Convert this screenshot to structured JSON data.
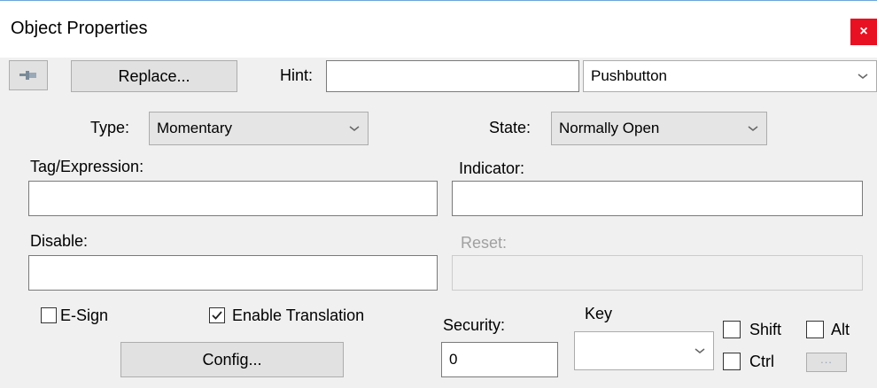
{
  "window": {
    "title": "Object Properties",
    "close_label": "×"
  },
  "toolbar": {
    "replace_label": "Replace...",
    "hint_label": "Hint:",
    "hint_value": "",
    "object_type": "Pushbutton"
  },
  "type": {
    "label": "Type:",
    "value": "Momentary"
  },
  "state": {
    "label": "State:",
    "value": "Normally Open"
  },
  "tag": {
    "label": "Tag/Expression:",
    "value": ""
  },
  "indicator": {
    "label": "Indicator:",
    "value": ""
  },
  "disable": {
    "label": "Disable:",
    "value": ""
  },
  "reset": {
    "label": "Reset:",
    "value": ""
  },
  "esign": {
    "label": "E-Sign",
    "checked": false
  },
  "translation": {
    "label": "Enable Translation",
    "checked": true
  },
  "config": {
    "label": "Config..."
  },
  "security": {
    "label": "Security:",
    "value": "0"
  },
  "key": {
    "label": "Key",
    "value": ""
  },
  "modifiers": {
    "shift_label": "Shift",
    "ctrl_label": "Ctrl",
    "alt_label": "Alt",
    "more_label": "..."
  },
  "colors": {
    "close": "#e81123",
    "window_bg": "#f0f0f0",
    "title_border": "#6aa5d9"
  }
}
